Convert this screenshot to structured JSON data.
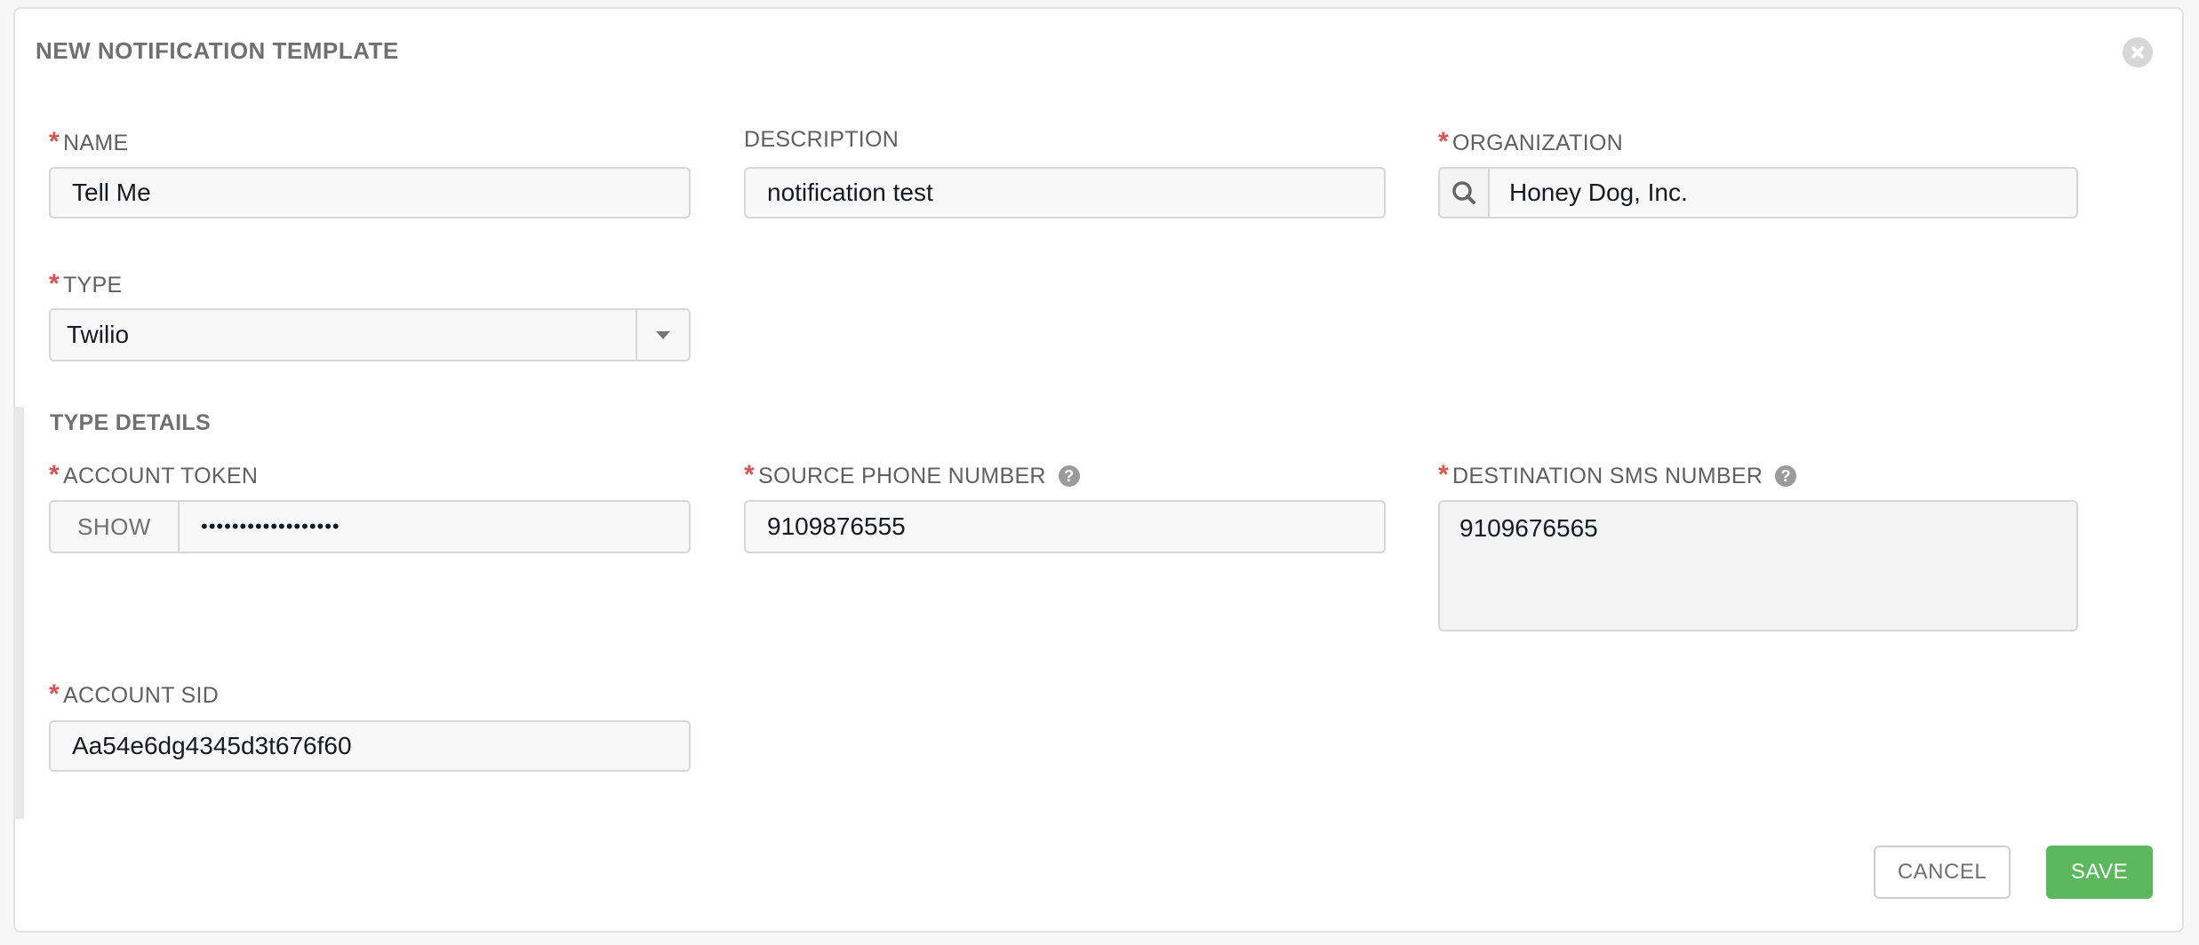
{
  "dialog": {
    "title": "NEW NOTIFICATION TEMPLATE"
  },
  "fields": {
    "name": {
      "label": "NAME",
      "required_mark": "*",
      "value": "Tell Me"
    },
    "description": {
      "label": "DESCRIPTION",
      "value": "notification test"
    },
    "organization": {
      "label": "ORGANIZATION",
      "required_mark": "*",
      "value": "Honey Dog, Inc.",
      "icon": "search-icon"
    },
    "type": {
      "label": "TYPE",
      "required_mark": "*",
      "value": "Twilio"
    }
  },
  "type_details": {
    "title": "TYPE DETAILS",
    "account_token": {
      "label": "ACCOUNT TOKEN",
      "required_mark": "*",
      "show_label": "SHOW",
      "value": "••••••••••••••••••"
    },
    "source_phone": {
      "label": "SOURCE PHONE NUMBER",
      "required_mark": "*",
      "help": "?",
      "value": "9109876555"
    },
    "destination_sms": {
      "label": "DESTINATION SMS NUMBER",
      "required_mark": "*",
      "help": "?",
      "value": "9109676565"
    },
    "account_sid": {
      "label": "ACCOUNT SID",
      "required_mark": "*",
      "value": "Aa54e6dg4345d3t676f60"
    }
  },
  "actions": {
    "cancel_label": "CANCEL",
    "save_label": "SAVE"
  },
  "colors": {
    "required": "#d9534f",
    "save": "#5cb85c"
  }
}
